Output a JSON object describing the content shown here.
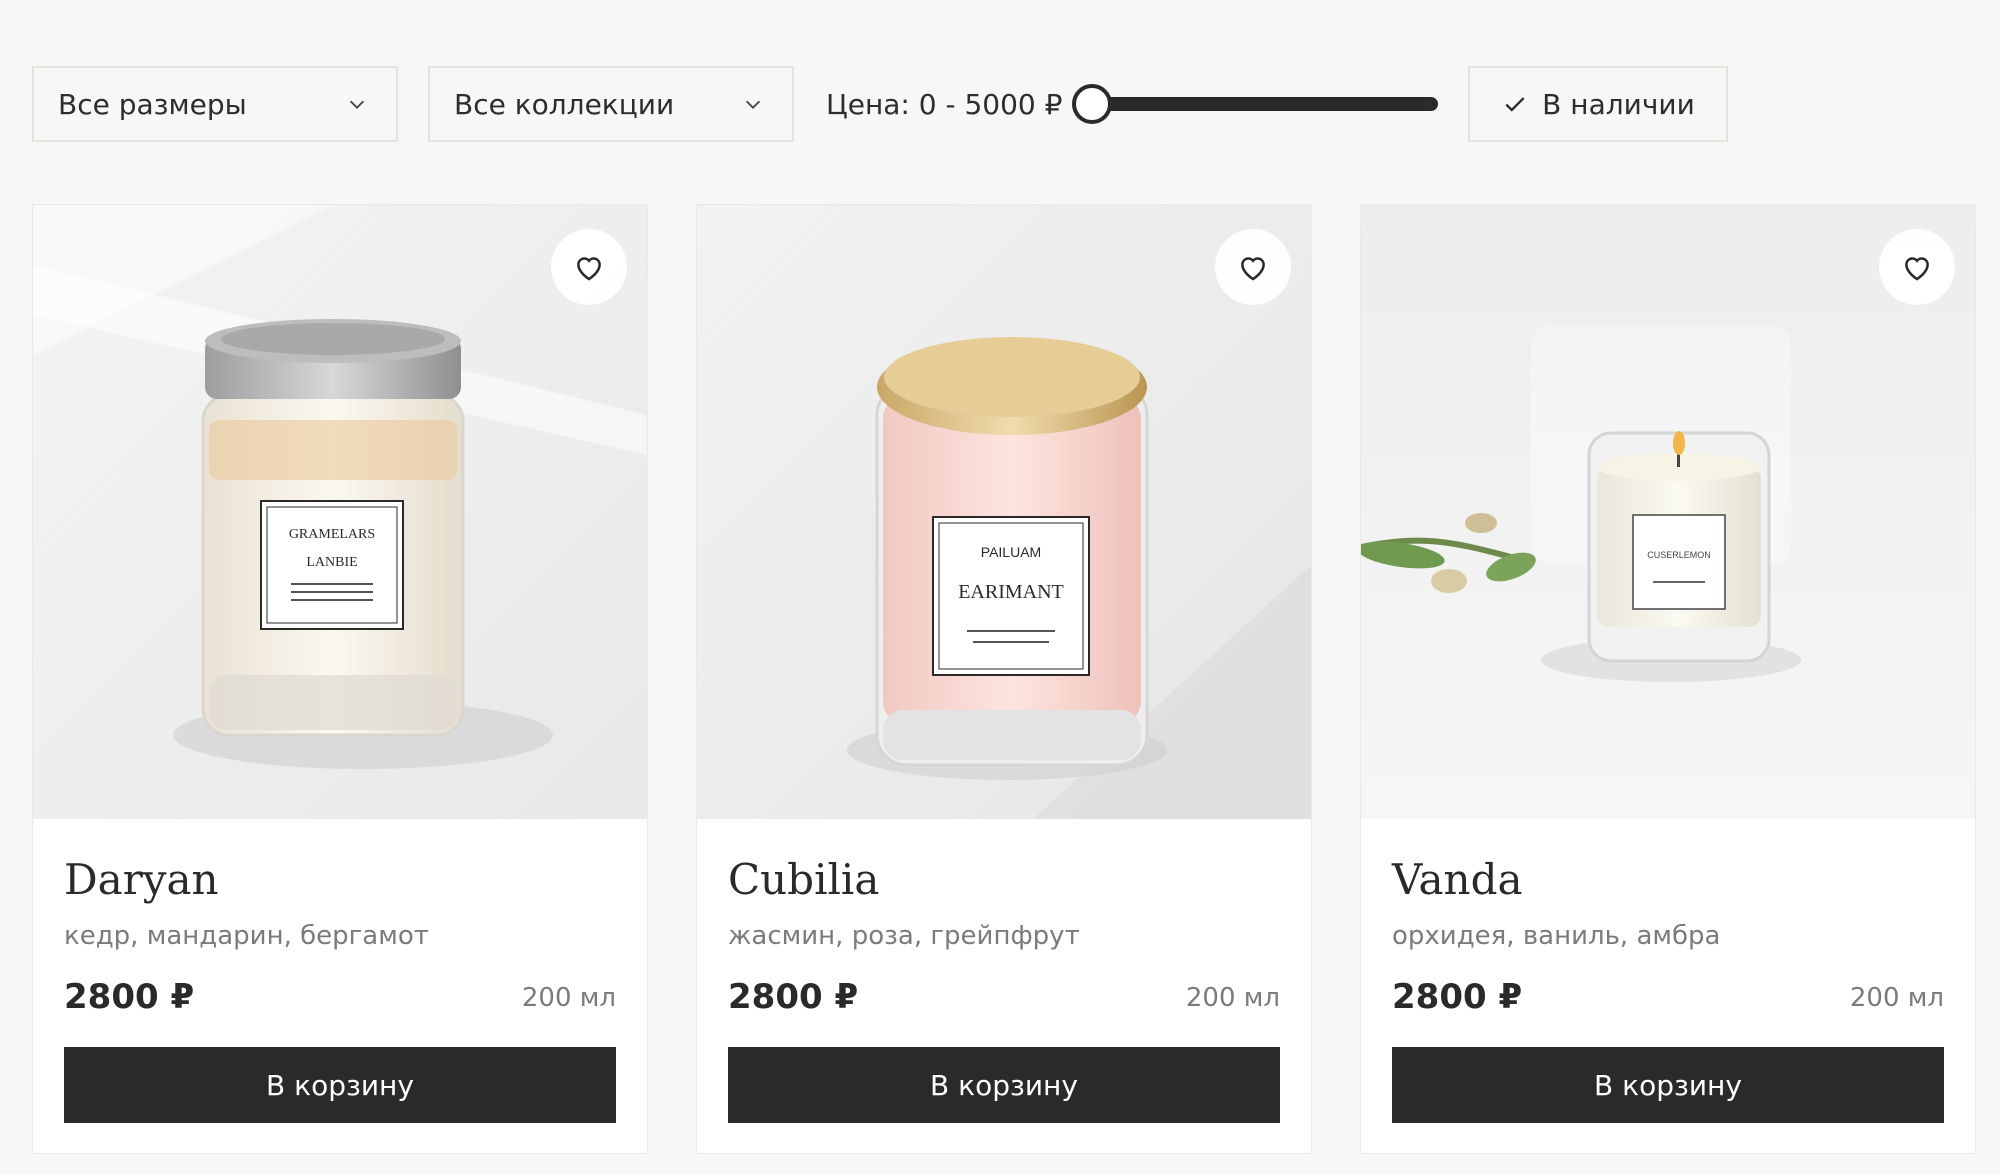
{
  "filters": {
    "size_select": "Все размеры",
    "collection_select": "Все коллекции",
    "price_label": "Цена: 0 - 5000 ₽",
    "price_min": 0,
    "price_max": 5000,
    "in_stock_label": "В наличии",
    "in_stock_checked": true
  },
  "products": [
    {
      "name": "Daryan",
      "notes": "кедр, мандарин, бергамот",
      "price": "2800 ₽",
      "volume": "200 мл",
      "cart_label": "В корзину",
      "jar_label": [
        "GRAMELARS",
        "LANBIE"
      ]
    },
    {
      "name": "Cubilia",
      "notes": "жасмин, роза, грейпфрут",
      "price": "2800 ₽",
      "volume": "200 мл",
      "cart_label": "В корзину",
      "jar_label": [
        "PAILUAM",
        "EARIMANT"
      ]
    },
    {
      "name": "Vanda",
      "notes": "орхидея, ваниль, амбра",
      "price": "2800 ₽",
      "volume": "200 мл",
      "cart_label": "В корзину",
      "jar_label": [
        "CUSERLEMON"
      ]
    }
  ],
  "colors": {
    "background": "#f8f7f5",
    "button": "#2a2a2a",
    "muted_text": "#7b7b7b"
  }
}
